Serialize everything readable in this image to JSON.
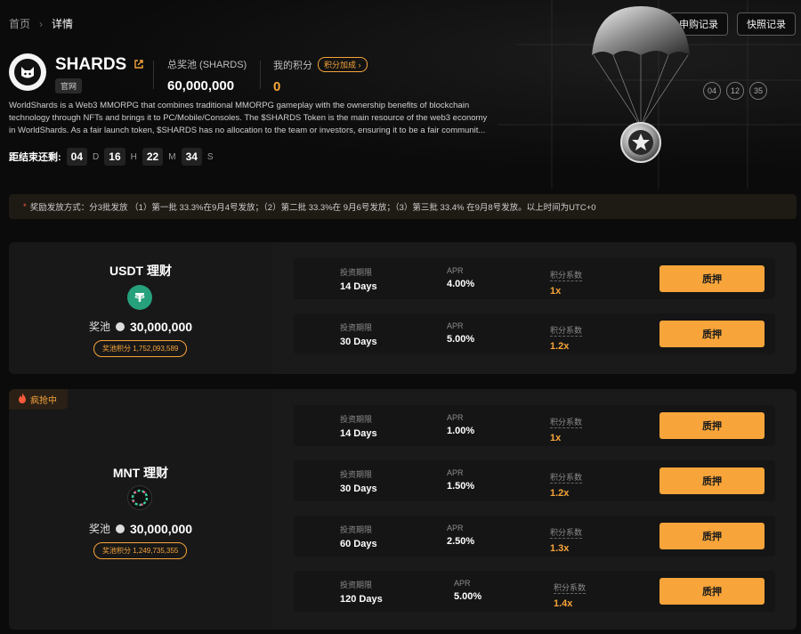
{
  "breadcrumb": {
    "home": "首页",
    "current": "详情"
  },
  "top_buttons": {
    "apply_records": "申购记录",
    "snapshot_records": "快照记录"
  },
  "token": {
    "name": "SHARDS",
    "official": "官网"
  },
  "stats": {
    "total_pool_label": "总奖池 (SHARDS)",
    "total_pool_value": "60,000,000",
    "my_points_label": "我的积分",
    "points_boost": "积分加成",
    "my_points_value": "0"
  },
  "description": "WorldShards is a Web3 MMORPG that combines traditional MMORPG gameplay with the ownership benefits of blockchain technology through NFTs and brings it to PC/Mobile/Consoles. The $SHARDS Token is the main resource of the web3 economy in WorldShards. As a fair launch token, $SHARDS has no allocation to the team or investors, ensuring it to be a fair communit...",
  "countdown": {
    "label": "距结束还剩:",
    "days": "04",
    "d": "D",
    "hours": "16",
    "h": "H",
    "minutes": "22",
    "m": "M",
    "seconds": "34",
    "s": "S"
  },
  "badge_numbers": [
    "04",
    "12",
    "35"
  ],
  "notice": {
    "star": "*",
    "text": "奖励发放方式：分3批发放 （1）第一批 33.3%在9月4号发放；（2）第二批 33.3%在 9月6号发放；（3）第三批 33.4% 在9月8号发放。以上时间为UTC+0"
  },
  "pools": [
    {
      "title": "USDT 理财",
      "pool_label": "奖池",
      "pool_value": "30,000,000",
      "pool_points": "奖池积分 1,752,093,589",
      "rows": [
        {
          "period_label": "投资期限",
          "period": "14 Days",
          "apr_label": "APR",
          "apr": "4.00%",
          "coef_label": "积分系数",
          "coef": "1x",
          "button": "质押"
        },
        {
          "period_label": "投资期限",
          "period": "30 Days",
          "apr_label": "APR",
          "apr": "5.00%",
          "coef_label": "积分系数",
          "coef": "1.2x",
          "button": "质押"
        }
      ]
    },
    {
      "hot": "疯抢中",
      "title": "MNT 理财",
      "pool_label": "奖池",
      "pool_value": "30,000,000",
      "pool_points": "奖池积分 1,249,735,355",
      "rows": [
        {
          "period_label": "投资期限",
          "period": "14 Days",
          "apr_label": "APR",
          "apr": "1.00%",
          "coef_label": "积分系数",
          "coef": "1x",
          "button": "质押"
        },
        {
          "period_label": "投资期限",
          "period": "30 Days",
          "apr_label": "APR",
          "apr": "1.50%",
          "coef_label": "积分系数",
          "coef": "1.2x",
          "button": "质押"
        },
        {
          "period_label": "投资期限",
          "period": "60 Days",
          "apr_label": "APR",
          "apr": "2.50%",
          "coef_label": "积分系数",
          "coef": "1.3x",
          "button": "质押"
        },
        {
          "period_label": "投资期限",
          "period": "120 Days",
          "apr_label": "APR",
          "apr": "5.00%",
          "coef_label": "积分系数",
          "coef": "1.4x",
          "button": "质押"
        }
      ]
    }
  ],
  "colors": {
    "accent": "#f7a43a",
    "usdt": "#26a17b",
    "background": "#0b0b0b"
  }
}
